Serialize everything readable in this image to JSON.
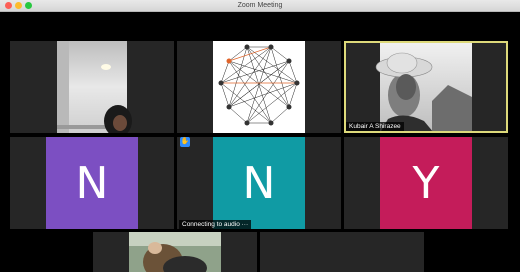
{
  "window": {
    "title": "Zoom Meeting"
  },
  "participants": [
    {
      "kind": "video",
      "scene": "room"
    },
    {
      "kind": "video",
      "scene": "graph"
    },
    {
      "kind": "video",
      "scene": "portrait",
      "name": "Kubair A Shirazee",
      "active_speaker": true
    },
    {
      "kind": "avatar",
      "initial": "N",
      "color": "#7c4fc2"
    },
    {
      "kind": "avatar",
      "initial": "N",
      "color": "#109ba4",
      "status": "Connecting to audio ···",
      "hand_raised": true
    },
    {
      "kind": "avatar",
      "initial": "Y",
      "color": "#c41c5a"
    },
    {
      "kind": "video",
      "scene": "outdoor"
    },
    {
      "kind": "empty"
    }
  ],
  "icons": {
    "raised_hand": "hand-icon"
  }
}
